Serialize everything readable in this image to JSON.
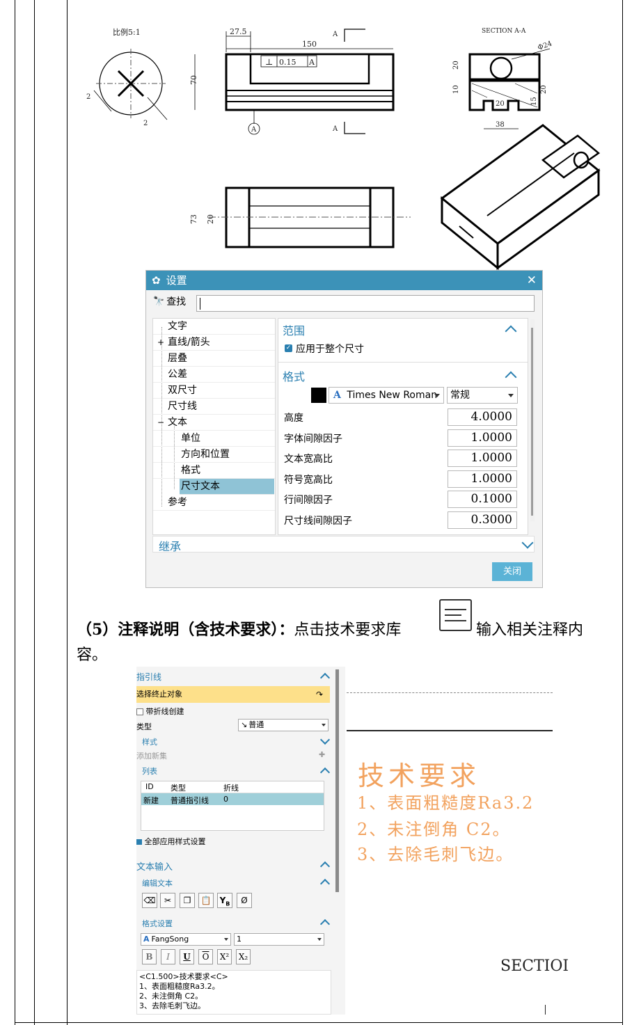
{
  "drawings": {
    "scale_label": "比例5:1",
    "dims": {
      "d_27_5": "27.5",
      "d_150": "150",
      "d_70": "70",
      "tolerance_sym": "⊥",
      "tolerance_val": "0.15",
      "datum_a": "A",
      "section_label": "SECTION A-A",
      "phi24": "Φ24",
      "d_20a": "20",
      "d_10": "10",
      "d_20b": "20",
      "d_15": "15",
      "d_20c": "20",
      "d_38": "38",
      "d_73": "73",
      "d_20d": "20",
      "d_2a": "2",
      "d_2b": "2"
    }
  },
  "settings_dialog": {
    "title": "设置",
    "find_label": "查找",
    "tree": [
      "文字",
      "直线/箭头",
      "层叠",
      "公差",
      "双尺寸",
      "尺寸线",
      "文本",
      "单位",
      "方向和位置",
      "格式",
      "尺寸文本",
      "参考"
    ],
    "scope": {
      "header": "范围",
      "apply_label": "应用于整个尺寸"
    },
    "format": {
      "header": "格式",
      "font": "Times New Roman",
      "style": "常规",
      "fields": [
        {
          "label": "高度",
          "value": "4.0000"
        },
        {
          "label": "字体间隙因子",
          "value": "1.0000"
        },
        {
          "label": "文本宽高比",
          "value": "1.0000"
        },
        {
          "label": "符号宽高比",
          "value": "1.0000"
        },
        {
          "label": "行间隙因子",
          "value": "0.1000"
        },
        {
          "label": "尺寸线间隙因子",
          "value": "0.3000"
        }
      ]
    },
    "inherit_label": "继承",
    "close_label": "关闭"
  },
  "paragraph": {
    "prefix": "（5）注释说明（含技术要求）",
    "colon": "：",
    "text1": "点击技术要求库",
    "text2": "输入相关注释内",
    "text3": "容。"
  },
  "annotation_panel": {
    "leader_header": "指引线",
    "select_end": "选择终止对象",
    "with_jog": "带折线创建",
    "type_label": "类型",
    "type_value": "普通",
    "style_header": "样式",
    "add_new_set": "添加新集",
    "list_header": "列表",
    "list_columns": [
      "ID",
      "类型",
      "折线"
    ],
    "list_row": [
      "新建",
      "普通指引线",
      "0"
    ],
    "apply_all": "全部应用样式设置",
    "text_input_header": "文本输入",
    "edit_text_header": "编辑文本",
    "format_header": "格式设置",
    "font": "FangSong",
    "size": "1",
    "format_buttons": [
      "B",
      "I",
      "U",
      "O",
      "X²",
      "X₂"
    ],
    "text_lines": [
      "<C1.500>技术要求<C>",
      "1、表面粗糙度Ra3.2。",
      "2、未注倒角 C2。",
      "3、去除毛刺飞边。"
    ]
  },
  "canvas_preview": {
    "title": "技术要求",
    "lines": [
      "1、表面粗糙度Ra3.2",
      "2、未注倒角 C2。",
      "3、去除毛刺飞边。"
    ],
    "section_text": "SECTIOI",
    "text_color": "#f2a25e"
  },
  "colors": {
    "dialog_title": "#3c92b8",
    "accent": "#2a7fb0",
    "selected_tree": "#8fc3d6",
    "highlight": "#fde08a"
  }
}
